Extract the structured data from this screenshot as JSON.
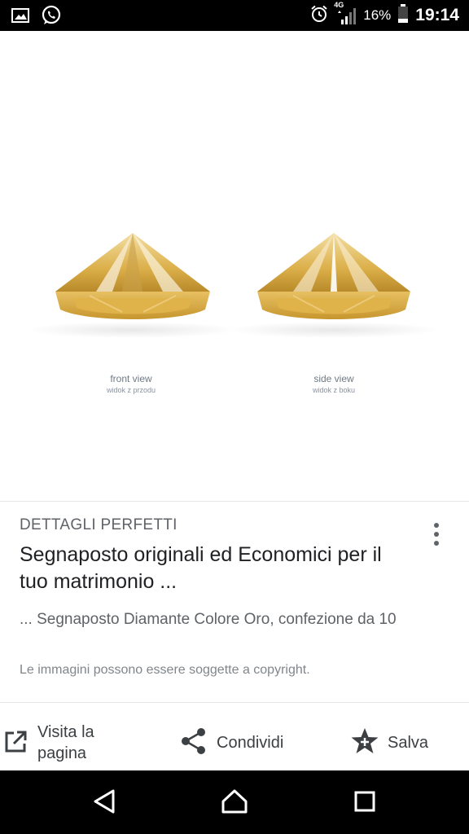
{
  "status_bar": {
    "network": "4G",
    "battery": "16%",
    "time": "19:14"
  },
  "image": {
    "captions": [
      {
        "main": "front view",
        "sub": "widok z przodu"
      },
      {
        "main": "side view",
        "sub": "widok z boku"
      }
    ]
  },
  "result": {
    "source": "DETTAGLI PERFETTI",
    "title": "Segnaposto originali ed Economici per il tuo matrimonio ...",
    "snippet": "... Segnaposto Diamante Colore Oro, confezione da 10",
    "copyright": "Le immagini possono essere soggette a copyright."
  },
  "actions": {
    "visit_line1": "Visita la",
    "visit_line2": "pagina",
    "share": "Condividi",
    "save": "Salva"
  },
  "icons": {
    "gallery": "image-icon",
    "whatsapp": "whatsapp-icon",
    "alarm": "alarm-icon",
    "signal": "signal-icon",
    "battery": "battery-icon",
    "open": "open-in-new-icon",
    "share": "share-icon",
    "save": "star-icon",
    "back": "back-icon",
    "home": "home-icon",
    "recents": "recents-icon"
  },
  "colors": {
    "status_bar": "#000000",
    "gold": "#d9a93b"
  }
}
